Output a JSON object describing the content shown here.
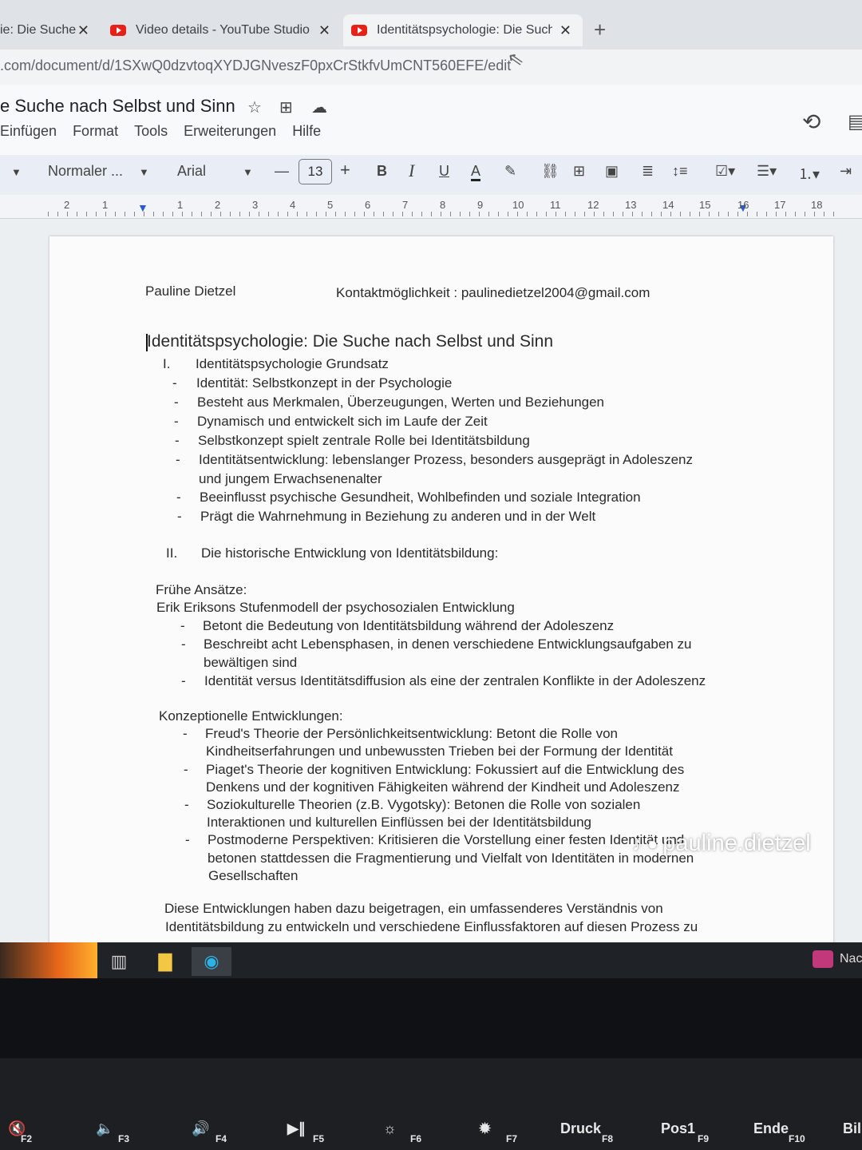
{
  "tabs": [
    {
      "label": "ie: Die Suche",
      "close": "✕"
    },
    {
      "label": "Video details - YouTube Studio",
      "close": "✕"
    },
    {
      "label": "Identitätspsychologie: Die Suche",
      "close": "✕"
    }
  ],
  "new_tab": "+",
  "url": ".com/document/d/1SXwQ0dzvtoqXYDJGNveszF0pxCrStkfvUmCNT560EFE/edit",
  "document": {
    "title": "e Suche nach Selbst und Sinn",
    "menu": [
      "Einfügen",
      "Format",
      "Tools",
      "Erweiterungen",
      "Hilfe"
    ]
  },
  "toolbar": {
    "style": "Normaler ...",
    "font": "Arial",
    "font_size": "13",
    "minus": "—",
    "plus": "+",
    "bold": "B",
    "italic": "I",
    "underline": "U",
    "text_color": "A"
  },
  "ruler": [
    "2",
    "1",
    "1",
    "2",
    "3",
    "4",
    "5",
    "6",
    "7",
    "8",
    "9",
    "10",
    "11",
    "12",
    "13",
    "14",
    "15",
    "16",
    "17",
    "18"
  ],
  "content": {
    "author": "Pauline Dietzel",
    "contact": "Kontaktmöglichkeit : paulinedietzel2004@gmail.com",
    "heading": "Identitätspsychologie: Die Suche nach Selbst und Sinn",
    "section1_num": "I.",
    "section1_title": "Identitätspsychologie Grundsatz",
    "section1_items": [
      "Identität: Selbstkonzept in der Psychologie",
      "Besteht aus Merkmalen, Überzeugungen, Werten und Beziehungen",
      "Dynamisch und entwickelt sich im Laufe der Zeit",
      "Selbstkonzept spielt zentrale Rolle bei Identitätsbildung",
      "Identitätsentwicklung: lebenslanger Prozess, besonders ausgeprägt in Adoleszenz",
      "und jungem Erwachsenenalter",
      "Beeinflusst psychische Gesundheit, Wohlbefinden und soziale Integration",
      "Prägt die Wahrnehmung in Beziehung zu anderen und in der Welt"
    ],
    "section2_num": "II.",
    "section2_title": "Die historische Entwicklung von Identitätsbildung:",
    "early_label": "Frühe Ansätze:",
    "erikson": "Erik Eriksons Stufenmodell der psychosozialen Entwicklung",
    "erikson_items": [
      "Betont die Bedeutung von Identitätsbildung während der Adoleszenz",
      "Beschreibt acht Lebensphasen, in denen verschiedene Entwicklungsaufgaben zu",
      "bewältigen sind",
      "Identität versus Identitätsdiffusion als eine der zentralen Konflikte in der Adoleszenz"
    ],
    "concept_label": "Konzeptionelle Entwicklungen:",
    "concept_items": [
      "Freud's Theorie der Persönlichkeitsentwicklung: Betont die Rolle von",
      "Kindheitserfahrungen und unbewussten Trieben bei der Formung der Identität",
      "Piaget's Theorie der kognitiven Entwicklung: Fokussiert auf die Entwicklung des",
      "Denkens und der kognitiven Fähigkeiten während der Kindheit und Adoleszenz",
      "Soziokulturelle Theorien (z.B. Vygotsky): Betonen die Rolle von sozialen",
      "Interaktionen und kulturellen Einflüssen bei der Identitätsbildung",
      "Postmoderne Perspektiven: Kritisieren die Vorstellung einer festen Identität und",
      "betonen stattdessen die Fragmentierung und Vielfalt von Identitäten in modernen",
      "Gesellschaften"
    ],
    "conclusion": [
      "Diese Entwicklungen haben dazu beigetragen, ein umfassenderes Verständnis von",
      "Identitätsbildung zu entwickeln und verschiedene Einflussfaktoren auf diesen Prozess zu"
    ]
  },
  "watermark": "pauline.dietzel",
  "taskbar_right": "Nac",
  "keys": [
    {
      "label": "",
      "fn": "F2"
    },
    {
      "label": "",
      "fn": "F3"
    },
    {
      "label": "",
      "fn": "F4"
    },
    {
      "label": "",
      "fn": "F5"
    },
    {
      "label": "",
      "fn": "F6"
    },
    {
      "label": "",
      "fn": "F7"
    },
    {
      "label": "Druck",
      "fn": "F8"
    },
    {
      "label": "Pos1",
      "fn": "F9"
    },
    {
      "label": "Ende",
      "fn": "F10"
    },
    {
      "label": "Bil",
      "fn": ""
    }
  ],
  "colors": {
    "youtube_red": "#e62117",
    "toolbar_bg": "#e9eef6",
    "taskbar_bg": "#1f2226"
  }
}
